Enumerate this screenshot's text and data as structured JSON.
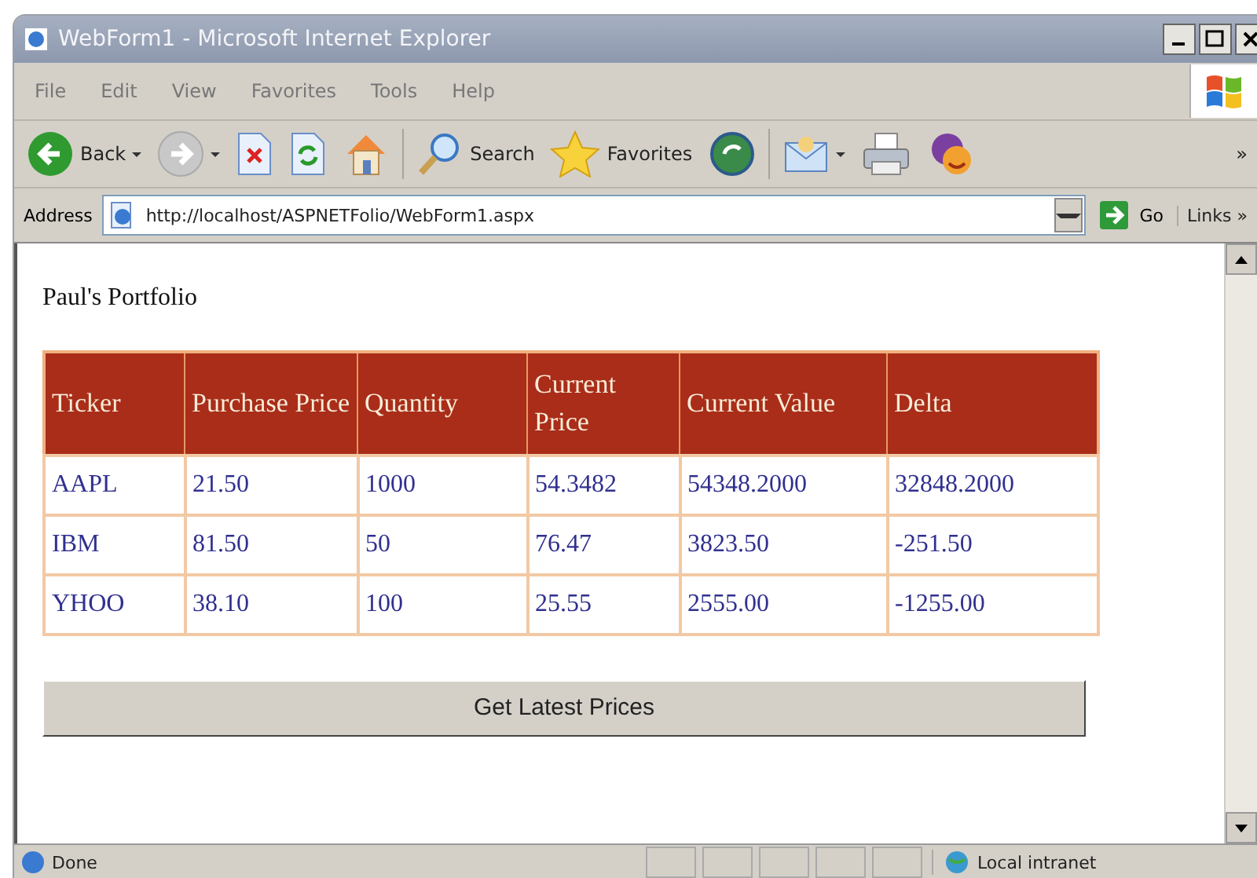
{
  "window": {
    "title": "WebForm1 - Microsoft Internet Explorer"
  },
  "menu": [
    "File",
    "Edit",
    "View",
    "Favorites",
    "Tools",
    "Help"
  ],
  "toolbar": {
    "items": [
      {
        "kind": "back",
        "label": "Back",
        "dropdown": true
      },
      {
        "kind": "forward",
        "dropdown": true
      },
      {
        "kind": "stop"
      },
      {
        "kind": "refresh"
      },
      {
        "kind": "home"
      },
      {
        "kind": "search",
        "label": "Search"
      },
      {
        "kind": "favorites",
        "label": "Favorites"
      },
      {
        "kind": "media"
      },
      {
        "kind": "mail",
        "dropdown": true
      },
      {
        "kind": "print"
      },
      {
        "kind": "messenger"
      }
    ],
    "more": "»"
  },
  "address": {
    "label": "Address",
    "value": "http://localhost/ASPNETFolio/WebForm1.aspx",
    "go": "Go",
    "links": "Links",
    "links_more": "»"
  },
  "page": {
    "heading": "Paul's Portfolio",
    "table": {
      "columns": [
        "Ticker",
        "Purchase Price",
        "Quantity",
        "Current Price",
        "Current Value",
        "Delta"
      ],
      "rows": [
        [
          "AAPL",
          "21.50",
          "1000",
          "54.3482",
          "54348.2000",
          "32848.2000"
        ],
        [
          "IBM",
          "81.50",
          "50",
          "76.47",
          "3823.50",
          "-251.50"
        ],
        [
          "YHOO",
          "38.10",
          "100",
          "25.55",
          "2555.00",
          "-1255.00"
        ]
      ]
    },
    "button": "Get Latest Prices"
  },
  "status_bar": {
    "text": "Done",
    "zone": "Local intranet"
  }
}
